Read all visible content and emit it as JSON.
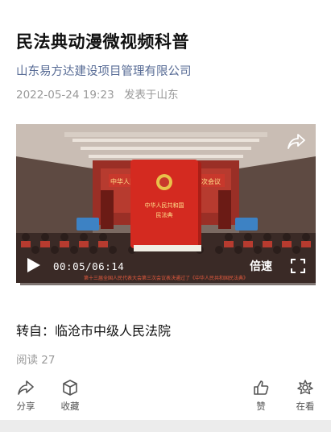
{
  "article": {
    "title": "民法典动漫微视频科普",
    "author": "山东易方达建设项目管理有限公司",
    "datetime": "2022-05-24 19:23",
    "location": "发表于山东",
    "repost_source": "转自：临沧市中级人民法院",
    "reads": "阅读 27"
  },
  "video": {
    "time_display": "00:05/06:14",
    "speed_label": "倍速",
    "progress": 0.013,
    "book_title_line1": "中华人民共和国",
    "book_title_line2": "民法典",
    "banner_left": "中华人民",
    "banner_right": "三次会议",
    "subtitle": "第十三届全国人民代表大会第三次会议表决通过了《中华人民共和国民法典》"
  },
  "actions": {
    "share": "分享",
    "favorite": "收藏",
    "like": "赞",
    "wow": "在看"
  },
  "colors": {
    "author_link": "#576b95",
    "muted": "#9a9a9a",
    "book_red": "#d42a20"
  }
}
